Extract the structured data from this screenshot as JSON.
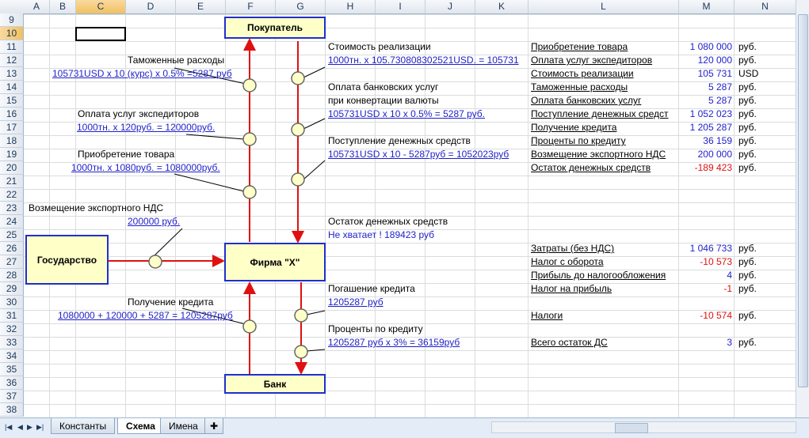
{
  "columns": [
    "A",
    "B",
    "C",
    "D",
    "E",
    "F",
    "G",
    "H",
    "I",
    "J",
    "K",
    "L",
    "M",
    "N"
  ],
  "rows": [
    "9",
    "10",
    "11",
    "12",
    "13",
    "14",
    "15",
    "16",
    "17",
    "18",
    "19",
    "20",
    "21",
    "22",
    "23",
    "24",
    "25",
    "26",
    "27",
    "28",
    "29",
    "30",
    "31",
    "32",
    "33",
    "34",
    "35",
    "36",
    "37",
    "38"
  ],
  "selected_column": "C",
  "selected_row": "10",
  "boxes": {
    "buyer": "Покупатель",
    "firm": "Фирма \"Х\"",
    "state": "Государство",
    "bank": "Банк"
  },
  "left_notes": {
    "customs_title": "Таможенные расходы",
    "customs_calc": "105731USD x 10 (курс) x 0.5% =5287 руб",
    "forwarder_title": "Оплата услуг экспедиторов",
    "forwarder_calc": "1000тн. x 120руб. = 120000руб.",
    "goods_title": "Приобретение товара",
    "goods_calc": "1000тн. x 1080руб. = 1080000руб.",
    "vat_title": "Возмещение экспортного НДС",
    "vat_calc": "200000 руб.",
    "credit_title": "Получение кредита",
    "credit_calc": "1080000 + 120000 + 5287 = 1205287руб"
  },
  "middle_notes": {
    "sales_title": "Стоимость реализации",
    "sales_calc": "1000тн. x 105.730808302521USD. = 105731",
    "bank_title": "Оплата банковских услуг",
    "bank_title2": "при конвертации валюты",
    "bank_calc": "105731USD x 10 x 0.5% = 5287 руб.",
    "inflow_title": "Поступление денежных средств",
    "inflow_calc": "105731USD x 10 - 5287руб = 1052023руб",
    "balance_title": "Остаток денежных средств",
    "balance_note": "Не хватает ! 189423 руб",
    "repay_title": "Погашение кредита",
    "repay_calc": "1205287 руб",
    "interest_title": "Проценты по кредиту",
    "interest_calc": "1205287 руб x 3% = 36159руб"
  },
  "summary": [
    {
      "label": "Приобретение товара",
      "value": "1 080 000",
      "unit": "руб.",
      "row": 11,
      "red": false
    },
    {
      "label": "Оплата услуг экспедиторов",
      "value": "120 000",
      "unit": "руб.",
      "row": 12,
      "red": false
    },
    {
      "label": "Стоимость реализации",
      "value": "105 731",
      "unit": "USD",
      "row": 13,
      "red": false
    },
    {
      "label": "Таможенные расходы",
      "value": "5 287",
      "unit": "руб.",
      "row": 14,
      "red": false
    },
    {
      "label": "Оплата банковских услуг",
      "value": "5 287",
      "unit": "руб.",
      "row": 15,
      "red": false
    },
    {
      "label": "Поступление денежных средст",
      "value": "1 052 023",
      "unit": "руб.",
      "row": 16,
      "red": false
    },
    {
      "label": "Получение кредита",
      "value": "1 205 287",
      "unit": "руб.",
      "row": 17,
      "red": false
    },
    {
      "label": "Проценты по кредиту",
      "value": "36 159",
      "unit": "руб.",
      "row": 18,
      "red": false
    },
    {
      "label": "Возмещение экспортного НДС",
      "value": "200 000",
      "unit": "руб.",
      "row": 19,
      "red": false
    },
    {
      "label": "Остаток денежных средств",
      "value": "-189 423",
      "unit": "руб.",
      "row": 20,
      "red": true
    },
    {
      "label": "Затраты (без НДС)",
      "value": "1 046 733",
      "unit": "руб.",
      "row": 26,
      "red": false
    },
    {
      "label": "Налог с оборота",
      "value": "-10 573",
      "unit": "руб.",
      "row": 27,
      "red": true
    },
    {
      "label": "Прибыль до налогообложения",
      "value": "4",
      "unit": "руб.",
      "row": 28,
      "red": false
    },
    {
      "label": "Налог на прибыль",
      "value": "-1",
      "unit": "руб.",
      "row": 29,
      "red": true
    },
    {
      "label": "Налоги",
      "value": "-10 574",
      "unit": "руб.",
      "row": 31,
      "red": true
    },
    {
      "label": "Всего остаток ДС",
      "value": "3",
      "unit": "руб.",
      "row": 33,
      "red": false
    }
  ],
  "sheet_tabs": [
    "Константы",
    "Схема",
    "Имена"
  ],
  "active_tab": "Схема",
  "colors": {
    "arrow": "#e01010",
    "box_border": "#1f2fd0",
    "box_fill": "#ffffc8",
    "link": "#1f1fc8"
  }
}
